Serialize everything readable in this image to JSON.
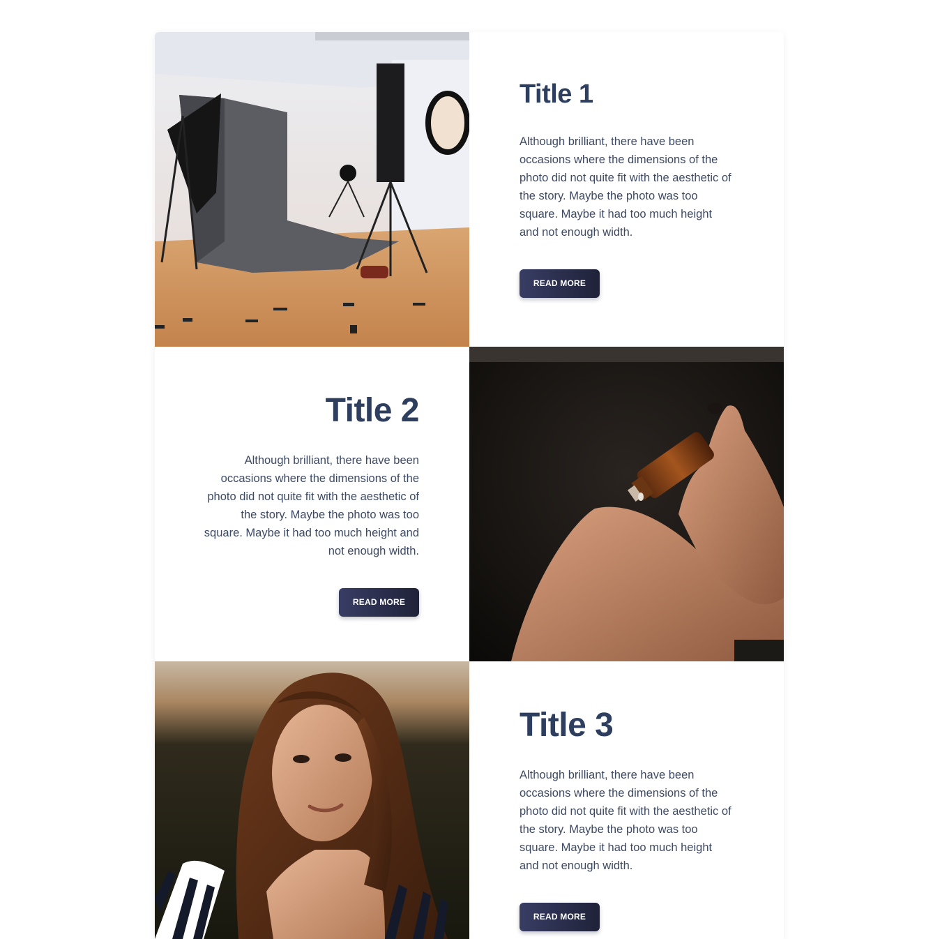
{
  "cards": [
    {
      "title": "Title 1",
      "body": "Although brilliant, there have been occasions where the dimensions of the photo did not quite fit with the aesthetic of the story. Maybe the photo was too square. Maybe it had too much height and not enough width.",
      "button_label": "READ MORE"
    },
    {
      "title": "Title 2",
      "body": "Although brilliant, there have been occasions where the dimensions of the photo did not quite fit with the aesthetic of the story. Maybe the photo was too square. Maybe it had too much height and not enough width.",
      "button_label": "READ MORE"
    },
    {
      "title": "Title 3",
      "body": "Although brilliant, there have been occasions where the dimensions of the photo did not quite fit with the aesthetic of the story. Maybe the photo was too square. Maybe it had too much height and not enough width.",
      "button_label": "READ MORE"
    }
  ],
  "colors": {
    "title": "#2d3e5e",
    "body_text": "#3d4a63",
    "button_start": "#383d64",
    "button_end": "#1f2238"
  }
}
